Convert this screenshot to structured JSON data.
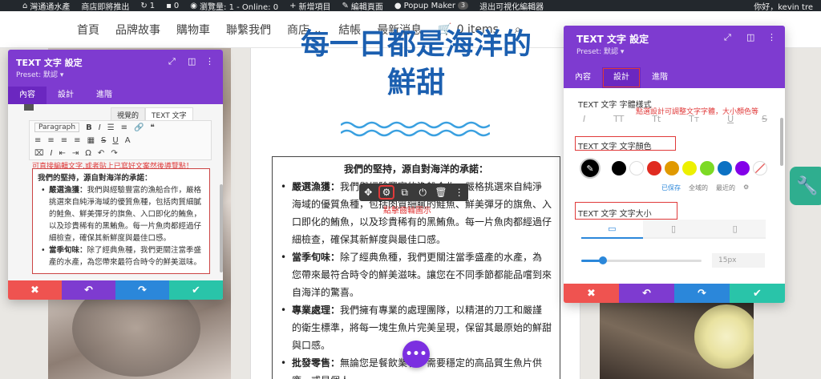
{
  "admin_bar": {
    "site_name": "灣通通水產",
    "store_notice": "商店即將推出",
    "updates_count": "1",
    "comments_count": "0",
    "views_text": "瀏覽量: 1 - Online: 0",
    "new_item": "新增項目",
    "edit_page": "編輯頁面",
    "popup_maker": "Popup Maker",
    "popup_count": "3",
    "exit_builder": "退出可視化編輯器",
    "greeting": "你好，kevin tre"
  },
  "site_nav": {
    "items": [
      "首頁",
      "品牌故事",
      "購物車",
      "聯繫我們",
      "商店",
      "結帳",
      "最新消息"
    ],
    "cart_label": "0 items"
  },
  "content": {
    "heading_line1": "每一日都是海洋的",
    "heading_line2": "鮮甜",
    "box_title": "我們的堅持，源自對海洋的承諾：",
    "p1_label": "嚴選漁獲：",
    "p1_text": "我們與經驗豐富的漁船合作，嚴格挑選來自純淨海域的優質魚種，包括肉質細膩的鮭魚、鮮美彈牙的旗魚、入口即化的鮪魚，以及珍貴稀有的黑鮪魚。每一片魚肉都經過仔細檢查，確保其新鮮度與最佳口感。",
    "p2_label": "當季旬味：",
    "p2_text": "除了經典魚種，我們更關注當季盛產的水產，為您帶來最符合時令的鮮美滋味。讓您在不同季節都能品嚐到來自海洋的驚喜。",
    "p3_label": "專業處理：",
    "p3_text": "我們擁有專業的處理團隊，以精湛的刀工和嚴謹的衛生標準，將每一塊生魚片完美呈現，保留其最原始的鮮甜與口感。",
    "p4_label": "批發零售：",
    "p4_text": "無論您是餐飲業者，需要穩定的高品質生魚片供應，或是個人"
  },
  "module_toolbar": {
    "tip": "點擊齒輪圖示"
  },
  "panel_left": {
    "title": "TEXT 文字 設定",
    "preset": "Preset: 默認 ▾",
    "tabs": [
      "內容",
      "設計",
      "進階"
    ],
    "tab_visual": "視覺的",
    "tab_text": "TEXT 文字",
    "paragraph_select": "Paragraph",
    "tip": "可直接編輯文字,或者貼上已寫好文案然後導覽點！",
    "body_title": "我們的堅持，源自對海洋的承諾：",
    "b1_label": "嚴選漁獲：",
    "b1_text": "我們與經驗豐富的漁船合作，嚴格挑選來自純淨海域的優質魚種，包括肉質細膩的鮭魚、鮮美彈牙的旗魚、入口即化的鮪魚，以及珍貴稀有的黑鮪魚。每一片魚肉都經過仔細檢查，確保其新鮮度與最佳口感。",
    "b2_label": "當季旬味：",
    "b2_text": "除了經典魚種，我們更關注當季盛產的水產，為您帶來最符合時令的鮮美滋味。"
  },
  "panel_right": {
    "title": "TEXT 文字 設定",
    "preset": "Preset: 默認 ▾",
    "tabs": [
      "內容",
      "設計",
      "進階"
    ],
    "font_style_label": "TEXT 文字 字體樣式",
    "font_tip": "點選設計可調整文字字體，大小顏色等",
    "text_color_label": "TEXT 文字 文字顏色",
    "saved_tab": "已保存",
    "global_tab": "全域的",
    "recent_tab": "最近的",
    "text_size_label": "TEXT 文字 文字大小",
    "size_value": "15px",
    "size_fraction": 0.18,
    "swatch_colors": [
      "#000000",
      "#ffffff",
      "#e02b20",
      "#e09900",
      "#edf000",
      "#7cda24",
      "#0c71c3",
      "#8300e9"
    ]
  }
}
